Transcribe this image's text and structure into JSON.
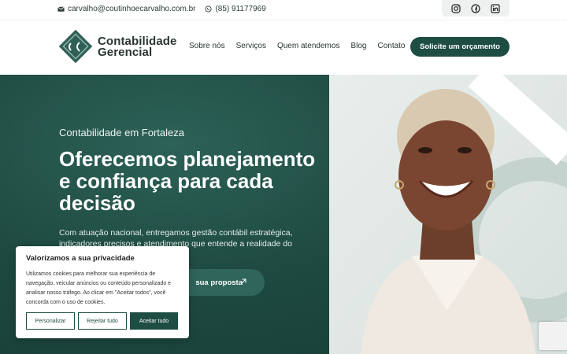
{
  "topbar": {
    "email": "carvalho@coutinhoecarvalho.com.br",
    "phone": "(85) 91177969",
    "social": [
      "instagram-icon",
      "facebook-icon",
      "linkedin-icon"
    ]
  },
  "header": {
    "logo_line1": "Contabilidade",
    "logo_line2": "Gerencial",
    "nav": [
      "Sobre nós",
      "Serviços",
      "Quem atendemos",
      "Blog",
      "Contato"
    ],
    "cta": "Solicite um orçamento"
  },
  "hero": {
    "kicker": "Contabilidade em Fortaleza",
    "headline_a": "Oferecemos ",
    "headline_b": "planejamento",
    "headline_c": "e confiança",
    "headline_d": " para cada decisão",
    "lead": "Com atuação nacional, entregamos gestão contábil estratégica, indicadores precisos e atendimento que entende a realidade do",
    "button": "sua proposta"
  },
  "cookie": {
    "title": "Valorizamos a sua privacidade",
    "text": "Utilizamos cookies para melhorar sua experiência de navegação, veicular anúncios ou conteúdo personalizado e analisar nosso tráfego. Ao clicar em \"Aceitar todos\", você concorda com o uso de cookies.",
    "customize": "Personalizar",
    "reject": "Rejeitar tudo",
    "accept": "Aceitar tudo"
  },
  "colors": {
    "brand": "#1e4d44",
    "hero_bg": "#1e4a41"
  }
}
